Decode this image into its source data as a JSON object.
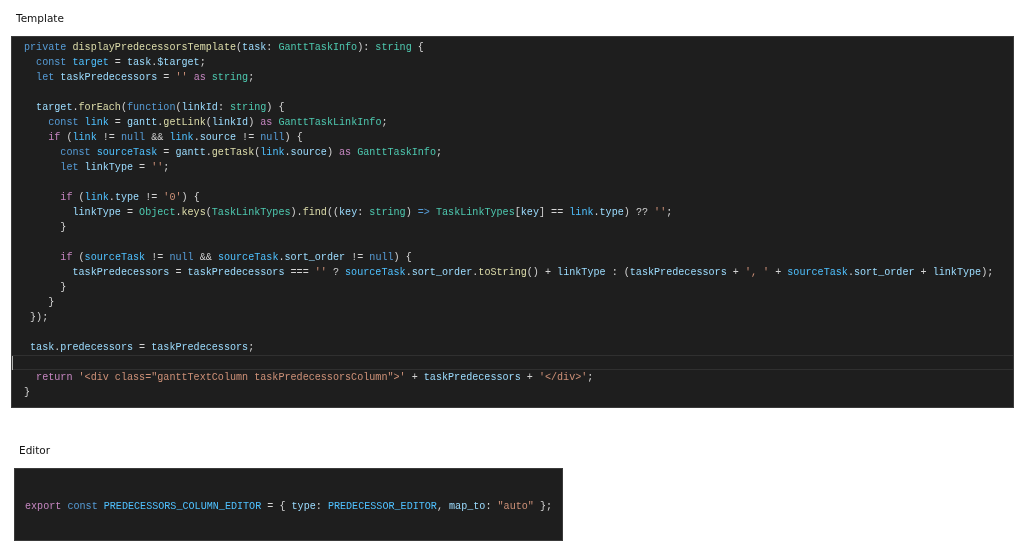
{
  "sections": [
    {
      "heading": "Template",
      "lines": [
        {
          "current": false,
          "tokens": [
            {
              "kind": "keyword",
              "text": "private"
            },
            {
              "kind": "function",
              "text": " displayPredecessorsTemplate"
            },
            {
              "kind": "plain",
              "text": "("
            },
            {
              "kind": "variable",
              "text": "task"
            },
            {
              "kind": "plain",
              "text": ": "
            },
            {
              "kind": "type",
              "text": "GanttTaskInfo"
            },
            {
              "kind": "plain",
              "text": "): "
            },
            {
              "kind": "type",
              "text": "string"
            },
            {
              "kind": "plain",
              "text": " {"
            }
          ]
        },
        {
          "current": false,
          "tokens": [
            {
              "kind": "keyword",
              "text": "  const"
            },
            {
              "kind": "constant",
              "text": " target"
            },
            {
              "kind": "plain",
              "text": " = "
            },
            {
              "kind": "variable",
              "text": "task"
            },
            {
              "kind": "plain",
              "text": "."
            },
            {
              "kind": "variable",
              "text": "$target"
            },
            {
              "kind": "plain",
              "text": ";"
            }
          ]
        },
        {
          "current": false,
          "tokens": [
            {
              "kind": "keyword",
              "text": "  let"
            },
            {
              "kind": "variable",
              "text": " taskPredecessors"
            },
            {
              "kind": "plain",
              "text": " = "
            },
            {
              "kind": "string",
              "text": "''"
            },
            {
              "kind": "control",
              "text": " as"
            },
            {
              "kind": "type",
              "text": " string"
            },
            {
              "kind": "plain",
              "text": ";"
            }
          ]
        },
        {
          "current": false
        },
        {
          "current": false,
          "tokens": [
            {
              "kind": "variable",
              "text": "  target"
            },
            {
              "kind": "plain",
              "text": "."
            },
            {
              "kind": "function",
              "text": "forEach"
            },
            {
              "kind": "plain",
              "text": "("
            },
            {
              "kind": "keyword",
              "text": "function"
            },
            {
              "kind": "plain",
              "text": "("
            },
            {
              "kind": "variable",
              "text": "linkId"
            },
            {
              "kind": "plain",
              "text": ": "
            },
            {
              "kind": "type",
              "text": "string"
            },
            {
              "kind": "plain",
              "text": ") {"
            }
          ]
        },
        {
          "current": false,
          "tokens": [
            {
              "kind": "keyword",
              "text": "    const"
            },
            {
              "kind": "constant",
              "text": " link"
            },
            {
              "kind": "plain",
              "text": " = "
            },
            {
              "kind": "variable",
              "text": "gantt"
            },
            {
              "kind": "plain",
              "text": "."
            },
            {
              "kind": "function",
              "text": "getLink"
            },
            {
              "kind": "plain",
              "text": "("
            },
            {
              "kind": "variable",
              "text": "linkId"
            },
            {
              "kind": "plain",
              "text": ") "
            },
            {
              "kind": "control",
              "text": "as"
            },
            {
              "kind": "type",
              "text": " GanttTaskLinkInfo"
            },
            {
              "kind": "plain",
              "text": ";"
            }
          ]
        },
        {
          "current": false,
          "tokens": [
            {
              "kind": "control",
              "text": "    if"
            },
            {
              "kind": "plain",
              "text": " ("
            },
            {
              "kind": "constant",
              "text": "link"
            },
            {
              "kind": "plain",
              "text": " != "
            },
            {
              "kind": "keyword",
              "text": "null"
            },
            {
              "kind": "plain",
              "text": " && "
            },
            {
              "kind": "constant",
              "text": "link"
            },
            {
              "kind": "plain",
              "text": "."
            },
            {
              "kind": "variable",
              "text": "source"
            },
            {
              "kind": "plain",
              "text": " != "
            },
            {
              "kind": "keyword",
              "text": "null"
            },
            {
              "kind": "plain",
              "text": ") {"
            }
          ]
        },
        {
          "current": false,
          "tokens": [
            {
              "kind": "keyword",
              "text": "      const"
            },
            {
              "kind": "constant",
              "text": " sourceTask"
            },
            {
              "kind": "plain",
              "text": " = "
            },
            {
              "kind": "variable",
              "text": "gantt"
            },
            {
              "kind": "plain",
              "text": "."
            },
            {
              "kind": "function",
              "text": "getTask"
            },
            {
              "kind": "plain",
              "text": "("
            },
            {
              "kind": "constant",
              "text": "link"
            },
            {
              "kind": "plain",
              "text": "."
            },
            {
              "kind": "variable",
              "text": "source"
            },
            {
              "kind": "plain",
              "text": ") "
            },
            {
              "kind": "control",
              "text": "as"
            },
            {
              "kind": "type",
              "text": " GanttTaskInfo"
            },
            {
              "kind": "plain",
              "text": ";"
            }
          ]
        },
        {
          "current": false,
          "tokens": [
            {
              "kind": "keyword",
              "text": "      let"
            },
            {
              "kind": "variable",
              "text": " linkType"
            },
            {
              "kind": "plain",
              "text": " = "
            },
            {
              "kind": "string",
              "text": "''"
            },
            {
              "kind": "plain",
              "text": ";"
            }
          ]
        },
        {
          "current": false
        },
        {
          "current": false,
          "tokens": [
            {
              "kind": "control",
              "text": "      if"
            },
            {
              "kind": "plain",
              "text": " ("
            },
            {
              "kind": "constant",
              "text": "link"
            },
            {
              "kind": "plain",
              "text": "."
            },
            {
              "kind": "variable",
              "text": "type"
            },
            {
              "kind": "plain",
              "text": " != "
            },
            {
              "kind": "string",
              "text": "'0'"
            },
            {
              "kind": "plain",
              "text": ") {"
            }
          ]
        },
        {
          "current": false,
          "tokens": [
            {
              "kind": "variable",
              "text": "        linkType"
            },
            {
              "kind": "plain",
              "text": " = "
            },
            {
              "kind": "type",
              "text": "Object"
            },
            {
              "kind": "plain",
              "text": "."
            },
            {
              "kind": "function",
              "text": "keys"
            },
            {
              "kind": "plain",
              "text": "("
            },
            {
              "kind": "type",
              "text": "TaskLinkTypes"
            },
            {
              "kind": "plain",
              "text": ")."
            },
            {
              "kind": "function",
              "text": "find"
            },
            {
              "kind": "plain",
              "text": "(("
            },
            {
              "kind": "variable",
              "text": "key"
            },
            {
              "kind": "plain",
              "text": ": "
            },
            {
              "kind": "type",
              "text": "string"
            },
            {
              "kind": "plain",
              "text": ") "
            },
            {
              "kind": "keyword",
              "text": "=>"
            },
            {
              "kind": "type",
              "text": " TaskLinkTypes"
            },
            {
              "kind": "plain",
              "text": "["
            },
            {
              "kind": "variable",
              "text": "key"
            },
            {
              "kind": "plain",
              "text": "] == "
            },
            {
              "kind": "constant",
              "text": "link"
            },
            {
              "kind": "plain",
              "text": "."
            },
            {
              "kind": "variable",
              "text": "type"
            },
            {
              "kind": "plain",
              "text": ") ?? "
            },
            {
              "kind": "string",
              "text": "''"
            },
            {
              "kind": "plain",
              "text": ";"
            }
          ]
        },
        {
          "current": false,
          "tokens": [
            {
              "kind": "plain",
              "text": "      }"
            }
          ]
        },
        {
          "current": false
        },
        {
          "current": false,
          "tokens": [
            {
              "kind": "control",
              "text": "      if"
            },
            {
              "kind": "plain",
              "text": " ("
            },
            {
              "kind": "constant",
              "text": "sourceTask"
            },
            {
              "kind": "plain",
              "text": " != "
            },
            {
              "kind": "keyword",
              "text": "null"
            },
            {
              "kind": "plain",
              "text": " && "
            },
            {
              "kind": "constant",
              "text": "sourceTask"
            },
            {
              "kind": "plain",
              "text": "."
            },
            {
              "kind": "variable",
              "text": "sort_order"
            },
            {
              "kind": "plain",
              "text": " != "
            },
            {
              "kind": "keyword",
              "text": "null"
            },
            {
              "kind": "plain",
              "text": ") {"
            }
          ]
        },
        {
          "current": false,
          "tokens": [
            {
              "kind": "variable",
              "text": "        taskPredecessors"
            },
            {
              "kind": "plain",
              "text": " = "
            },
            {
              "kind": "variable",
              "text": "taskPredecessors"
            },
            {
              "kind": "plain",
              "text": " === "
            },
            {
              "kind": "string",
              "text": "''"
            },
            {
              "kind": "plain",
              "text": " ? "
            },
            {
              "kind": "constant",
              "text": "sourceTask"
            },
            {
              "kind": "plain",
              "text": "."
            },
            {
              "kind": "variable",
              "text": "sort_order"
            },
            {
              "kind": "plain",
              "text": "."
            },
            {
              "kind": "function",
              "text": "toString"
            },
            {
              "kind": "plain",
              "text": "() + "
            },
            {
              "kind": "variable",
              "text": "linkType"
            },
            {
              "kind": "plain",
              "text": " : ("
            },
            {
              "kind": "variable",
              "text": "taskPredecessors"
            },
            {
              "kind": "plain",
              "text": " + "
            },
            {
              "kind": "string",
              "text": "', '"
            },
            {
              "kind": "plain",
              "text": " + "
            },
            {
              "kind": "constant",
              "text": "sourceTask"
            },
            {
              "kind": "plain",
              "text": "."
            },
            {
              "kind": "variable",
              "text": "sort_order"
            },
            {
              "kind": "plain",
              "text": " + "
            },
            {
              "kind": "variable",
              "text": "linkType"
            },
            {
              "kind": "plain",
              "text": ");"
            }
          ]
        },
        {
          "current": false,
          "tokens": [
            {
              "kind": "plain",
              "text": "      }"
            }
          ]
        },
        {
          "current": false,
          "tokens": [
            {
              "kind": "plain",
              "text": "    }"
            }
          ]
        },
        {
          "current": false,
          "tokens": [
            {
              "kind": "plain",
              "text": " });"
            }
          ]
        },
        {
          "current": false
        },
        {
          "current": false,
          "tokens": [
            {
              "kind": "variable",
              "text": " task"
            },
            {
              "kind": "plain",
              "text": "."
            },
            {
              "kind": "variable",
              "text": "predecessors"
            },
            {
              "kind": "plain",
              "text": " = "
            },
            {
              "kind": "variable",
              "text": "taskPredecessors"
            },
            {
              "kind": "plain",
              "text": ";"
            }
          ]
        },
        {
          "current": true
        },
        {
          "current": false,
          "tokens": [
            {
              "kind": "control",
              "text": "  return"
            },
            {
              "kind": "string",
              "text": " '<div class=\"ganttTextColumn taskPredecessorsColumn\">'"
            },
            {
              "kind": "plain",
              "text": " + "
            },
            {
              "kind": "variable",
              "text": "taskPredecessors"
            },
            {
              "kind": "plain",
              "text": " + "
            },
            {
              "kind": "string",
              "text": "'</div>'"
            },
            {
              "kind": "plain",
              "text": ";"
            }
          ]
        },
        {
          "current": false,
          "tokens": [
            {
              "kind": "plain",
              "text": "}"
            }
          ]
        }
      ]
    },
    {
      "heading": "Editor",
      "lines": [
        {
          "current": false,
          "tokens": [
            {
              "kind": "control",
              "text": "export"
            },
            {
              "kind": "keyword",
              "text": " const"
            },
            {
              "kind": "constant",
              "text": " PREDECESSORS_COLUMN_EDITOR"
            },
            {
              "kind": "plain",
              "text": " = { "
            },
            {
              "kind": "variable",
              "text": "type"
            },
            {
              "kind": "plain",
              "text": ": "
            },
            {
              "kind": "constant",
              "text": "PREDECESSOR_EDITOR"
            },
            {
              "kind": "plain",
              "text": ", "
            },
            {
              "kind": "variable",
              "text": "map_to"
            },
            {
              "kind": "plain",
              "text": ": "
            },
            {
              "kind": "string",
              "text": "\"auto\""
            },
            {
              "kind": "plain",
              "text": " };"
            }
          ]
        }
      ]
    }
  ]
}
